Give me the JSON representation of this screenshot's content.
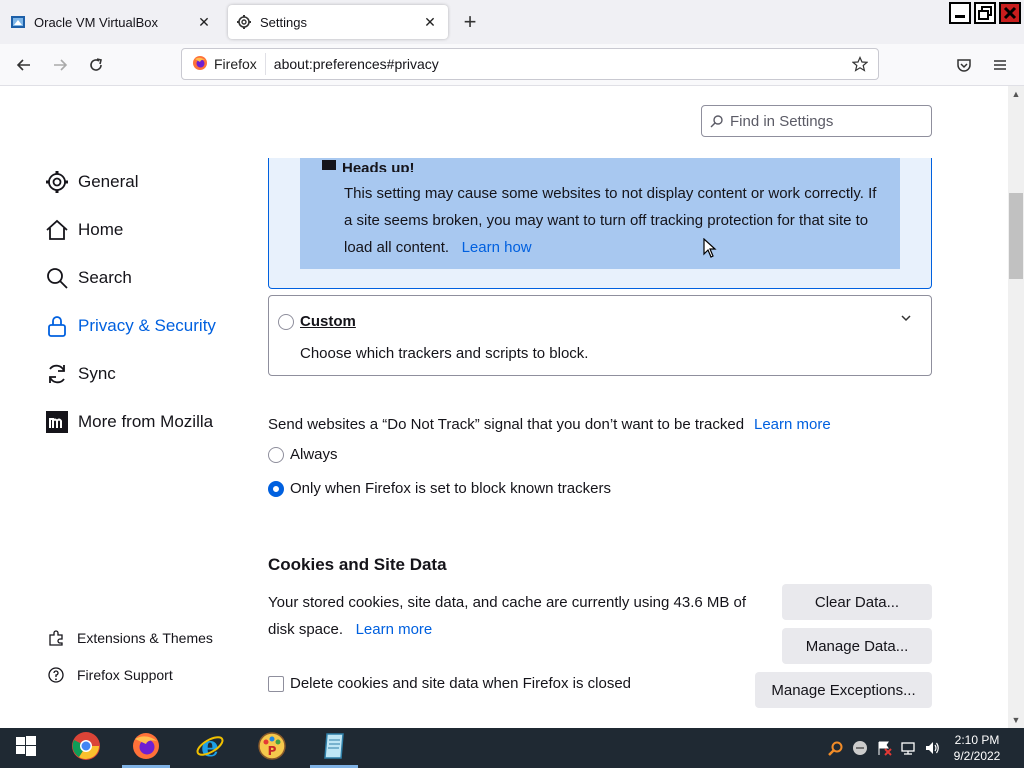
{
  "tabs": [
    {
      "label": "Oracle VM VirtualBox",
      "icon": "virtualbox-icon"
    },
    {
      "label": "Settings",
      "icon": "gear-icon",
      "active": true
    }
  ],
  "nav": {
    "browser_name": "Firefox",
    "url": "about:preferences#privacy"
  },
  "search": {
    "placeholder": "Find in Settings"
  },
  "sidebar": {
    "items": [
      {
        "label": "General",
        "icon": "gear-icon"
      },
      {
        "label": "Home",
        "icon": "home-icon"
      },
      {
        "label": "Search",
        "icon": "search-icon"
      },
      {
        "label": "Privacy & Security",
        "icon": "lock-icon",
        "active": true
      },
      {
        "label": "Sync",
        "icon": "sync-icon"
      },
      {
        "label": "More from Mozilla",
        "icon": "mozilla-icon"
      }
    ],
    "footer": [
      {
        "label": "Extensions & Themes",
        "icon": "puzzle-icon"
      },
      {
        "label": "Firefox Support",
        "icon": "help-icon"
      }
    ]
  },
  "tracking": {
    "heads_up_title": "Heads up!",
    "heads_up_text": "This setting may cause some websites to not display content or work correctly. If a site seems broken, you may want to turn off tracking protection for that site to load all content.",
    "heads_up_link": "Learn how",
    "custom_title": "Custom",
    "custom_desc": "Choose which trackers and scripts to block."
  },
  "dnt": {
    "text": "Send websites a “Do Not Track” signal that you don’t want to be tracked",
    "learn_more": "Learn more",
    "option_always": "Always",
    "option_only": "Only when Firefox is set to block known trackers",
    "selected": "only"
  },
  "cookies": {
    "title": "Cookies and Site Data",
    "text": "Your stored cookies, site data, and cache are currently using 43.6 MB of disk space.",
    "learn_more": "Learn more",
    "clear_button": "Clear Data...",
    "manage_button": "Manage Data...",
    "exceptions_button": "Manage Exceptions...",
    "delete_checkbox": "Delete cookies and site data when Firefox is closed"
  },
  "taskbar": {
    "time": "2:10 PM",
    "date": "9/2/2022",
    "apps": [
      "start-icon",
      "chrome-icon",
      "firefox-icon",
      "ie-icon",
      "paint-icon",
      "notepad-icon"
    ]
  },
  "colors": {
    "accent": "#0060df",
    "heads_up_bg": "#a8c8f0",
    "taskbar_bg": "#1f2933"
  }
}
